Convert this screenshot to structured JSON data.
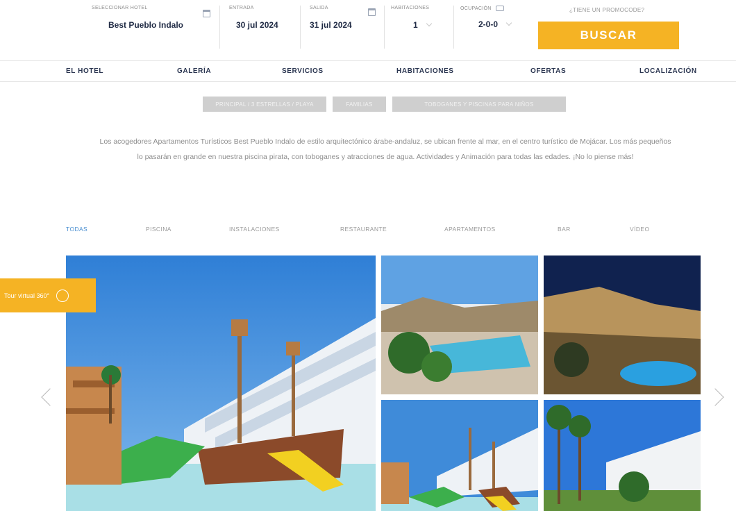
{
  "booking": {
    "hotel_label": "SELECCIONAR HOTEL",
    "hotel_value": "Best Pueblo Indalo",
    "checkin_label": "ENTRADA",
    "checkin_value": "30 jul 2024",
    "checkout_label": "SALIDA",
    "checkout_value": "31 jul 2024",
    "rooms_label": "HABITACIONES",
    "rooms_value": "1",
    "occupancy_label": "OCUPACIÓN",
    "occupancy_value": "2-0-0",
    "promo_label": "¿TIENE UN PROMOCODE?",
    "search_label": "BUSCAR",
    "accent_color": "#f5b324"
  },
  "nav": {
    "items": [
      {
        "label": "EL HOTEL"
      },
      {
        "label": "GALERÍA"
      },
      {
        "label": "SERVICIOS"
      },
      {
        "label": "HABITACIONES"
      },
      {
        "label": "OFERTAS"
      },
      {
        "label": "LOCALIZACIÓN"
      }
    ]
  },
  "chips": [
    {
      "label": "PRINCIPAL / 3 ESTRELLAS / PLAYA"
    },
    {
      "label": "FAMILIAS"
    },
    {
      "label": "TOBOGANES Y PISCINAS PARA NIÑOS"
    }
  ],
  "description": "Los acogedores Apartamentos Turísticos Best Pueblo Indalo de estilo arquitectónico árabe-andaluz, se ubican frente al mar, en el centro turístico de Mojácar. Los más pequeños lo pasarán en grande en nuestra piscina pirata, con toboganes y atracciones de agua. Actividades y Animación para todas las edades. ¡No lo piense más!",
  "gallery": {
    "tabs": [
      {
        "label": "TODAS"
      },
      {
        "label": "PISCINA"
      },
      {
        "label": "INSTALACIONES"
      },
      {
        "label": "RESTAURANTE"
      },
      {
        "label": "APARTAMENTOS"
      },
      {
        "label": "BAR"
      },
      {
        "label": "VÍDEO"
      }
    ],
    "active_tab": "TODAS"
  },
  "side_tab": {
    "label": "Tour virtual 360°"
  }
}
